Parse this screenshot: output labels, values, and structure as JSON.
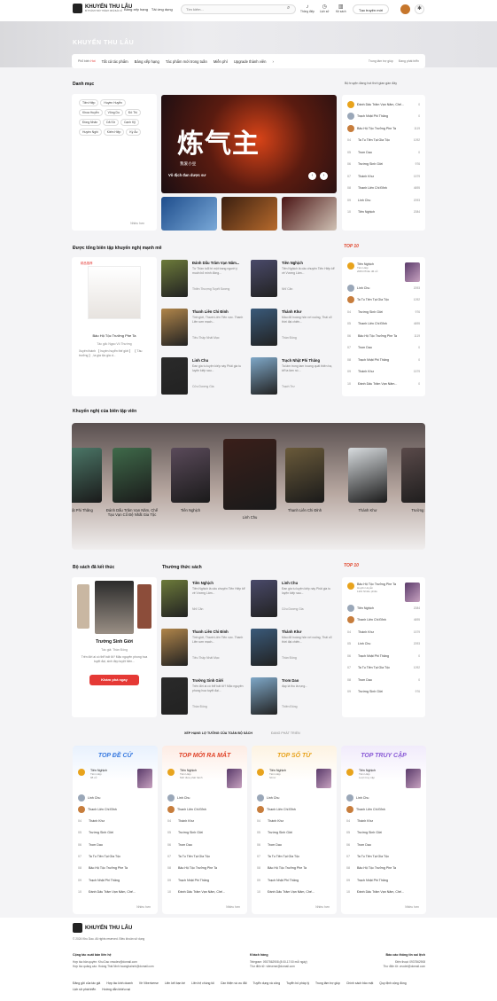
{
  "header": {
    "logo_title": "KHUYẾN THU LÂU",
    "logo_sub": "BÍ THÀNH TRỞ THÀNH NHÀ BÁC SĨ",
    "nav": [
      "Bảng xếp hạng",
      "Tải ứng dụng"
    ],
    "search_placeholder": "Tìm kiếm...",
    "icons": [
      {
        "label": "Thông điệp",
        "icon": "bell-icon"
      },
      {
        "label": "Lịch sử",
        "icon": "clock-icon"
      },
      {
        "label": "Kệ sách",
        "icon": "books-icon"
      }
    ],
    "create_label": "Tạo truyện mới"
  },
  "hero": {
    "title": "KHUYẾN THU LÂU"
  },
  "catbar": {
    "items": [
      "Phổ biến",
      "Tất cả tác phẩm",
      "Bảng xếp hạng",
      "Tác phẩm mới trong tuần",
      "Miễn phí",
      "Upgrade thành viên"
    ],
    "hot": "Hot",
    "right": [
      "Trung tâm trợ giúp",
      "Đang phát triển"
    ]
  },
  "categories": {
    "title": "Danh mục",
    "update_note": "Bộ truyện đang hot thời gian gần đây",
    "tags": [
      "Tiên Hiệp",
      "Huyền Huyễn",
      "Khoa Huyễn",
      "Võng Du",
      "Đô Thị",
      "Đồng Nhân",
      "Dã Sử",
      "Cạnh Kỹ",
      "Huyền Nghi",
      "Kiếm Hiệp",
      "Kỳ Ảo"
    ],
    "more": "Nhiều hơn"
  },
  "banner": {
    "title_art": "炼气主",
    "caption": "我爱小豆",
    "sub": "Vô địch đan dược sư"
  },
  "rank1": [
    {
      "name": "Đánh Dấu Trăm Vạn Năm, Chế...",
      "value": "0",
      "medal": "#e8a31c"
    },
    {
      "name": "Trạch Nhật Phi Thăng",
      "sub": "Tiên Hiệp",
      "sub2": "2 Không ảnh thủ",
      "value": "0",
      "medal": "#9aa7b8"
    },
    {
      "name": "Bảo Hộ Tộc Trưởng Phe Ta",
      "value": "1119",
      "medal": "#c77d3c"
    },
    {
      "name": "Ta Tu Tiên Tại Gia Tộc",
      "value": "1092",
      "n": "04"
    },
    {
      "name": "Trom Dao",
      "value": "0",
      "n": "05"
    },
    {
      "name": "Trường Sinh Giới",
      "value": "976",
      "n": "06"
    },
    {
      "name": "Thánh Khư",
      "value": "1579",
      "n": "07"
    },
    {
      "name": "Thanh Liên Chi Đỉnh",
      "value": "4695",
      "n": "08"
    },
    {
      "name": "Linh Chu",
      "value": "2093",
      "n": "09"
    },
    {
      "name": "Tiên Nghịch",
      "value": "2084",
      "n": "10"
    }
  ],
  "editor": {
    "title": "Được tổng biên tập khuyến nghị mạnh mẽ",
    "feature": {
      "badge": "精品推荐",
      "title": "Bảo Hộ Tộc Trưởng Phe Ta",
      "author": "Tác giả: Ngạo Vô Thường",
      "desc": "Xuyên thành 【 huyền huyễn thế giới 】 【 Tàu trưởng 】, ta gia tộc gia d..."
    },
    "books": [
      {
        "title": "Đánh Dấu Trăm Vạn Năm...",
        "desc": "Từ Thần tuổi tri một trang người ý muốn bỏ mình đồng...",
        "author": "Thiên Thượng Tuyết Sương"
      },
      {
        "title": "Tiên Nghịch",
        "desc": "Tiên Nghịch là câu chuyện Tiên Hiệp kể về Vương Lâm...",
        "author": "Nhĩ Căn"
      },
      {
        "title": "Thanh Liên Chi Đỉnh",
        "desc": "Tinh giới, Thanh Liên Tiên vực. Thanh Liên sơn mạch...",
        "author": "Tiêu Thập Nhất Mạc"
      },
      {
        "title": "Thánh Khư",
        "desc": "Màu đỏ hoàng hôn rơi xuống, Thái cổ thời đại chiến...",
        "author": "Thần Đông"
      },
      {
        "title": "Linh Chu",
        "desc": "Đan gia tu luyện kiếp này Phải gia tu luyện kiếp sau...",
        "author": "Cửu Dương Gia"
      },
      {
        "title": "Trạch Nhật Phi Thăng",
        "desc": "Ta làm trong tam hoang quát thiên hạ, kể ta làm nó ...",
        "author": "Trạch Trư"
      }
    ]
  },
  "top1": {
    "label": "TOP 10",
    "rows": [
      {
        "name": "Tiên Nghịch",
        "sub": "Tiên Hiệp",
        "sub2": "2084 Phiếu đề cử",
        "value": "",
        "medal": "#e8a31c"
      },
      {
        "name": "Linh Chu",
        "value": "2093",
        "medal": "#9aa7b8"
      },
      {
        "name": "Ta Tu Tiên Tại Gia Tộc",
        "value": "1092",
        "medal": "#c77d3c"
      },
      {
        "name": "Trường Sinh Giới",
        "value": "976",
        "n": "04"
      },
      {
        "name": "Thanh Liên Chi Đỉnh",
        "value": "4695",
        "n": "05"
      },
      {
        "name": "Bảo Hộ Tộc Trưởng Phe Ta",
        "value": "1119",
        "n": "06"
      },
      {
        "name": "Trom Dao",
        "value": "0",
        "n": "07"
      },
      {
        "name": "Trạch Nhật Phi Thăng",
        "value": "0",
        "n": "08"
      },
      {
        "name": "Thánh Khư",
        "value": "1579",
        "n": "09"
      },
      {
        "name": "Đánh Dấu Trăm Vạn Năm...",
        "value": "0",
        "n": "10"
      }
    ]
  },
  "carousel": {
    "title": "Khuyến nghị của biên tập viên",
    "items": [
      "ật Phi Thăng",
      "Đánh Dấu Trăm Vạn Năm, Chế Tạo Vạn Cổ Đệ Nhất Gia Tộc",
      "Tiên Nghịch",
      "Linh Chu",
      "Thanh Liên Chi Đỉnh",
      "Thánh Khư",
      "Trường Sin"
    ]
  },
  "finished": {
    "title": "Bộ sách đã kết thúc",
    "book": "Trường Sinh Giới",
    "author": "Tác giả: Thần Đông",
    "desc": "Trên đời ai có thể bất tử? Mặc nguyên phong hoa tuyệt đại, sinh đẹp tuyệt hiền...",
    "btn": "Khám phá ngay"
  },
  "common": {
    "title": "Thường thức sách",
    "books": [
      {
        "title": "Tiên Nghịch",
        "desc": "Tiên Nghịch là câu chuyện Tiên Hiệp kể về Vương Lâm...",
        "author": "Nhĩ Căn"
      },
      {
        "title": "Linh Chu",
        "desc": "Đan gia tu luyện kiếp này Phải gia tu luyện kiếp sau...",
        "author": "Cửu Dương Gia"
      },
      {
        "title": "Thanh Liên Chi Đỉnh",
        "desc": "Tinh giới, Thanh Liên Tiên vực. Thanh Liên sơn mạch...",
        "author": "Tiêu Thập Nhất Mạc"
      },
      {
        "title": "Thánh Khư",
        "desc": "Màu đỏ hoàng hôn rơi xuống, Thái cổ thời đại chiến...",
        "author": "Thần Đông"
      },
      {
        "title": "Trường Sinh Giới",
        "desc": "Trên đời ai có thể bất tử? Mặc nguyên phong hoa tuyệt đại...",
        "author": "Thần Đông"
      },
      {
        "title": "Trom Dao",
        "desc": "đạp lá thu lá rụng...",
        "author": "Thiên Đông"
      }
    ]
  },
  "top2": {
    "label": "TOP 10",
    "rows": [
      {
        "name": "Bảo Hộ Tộc Trưởng Phe Ta",
        "sub": "Huyền Huyễn",
        "sub2": "1119 Nhiều phiếu",
        "value": "",
        "medal": "#e8a31c"
      },
      {
        "name": "Tiên Nghịch",
        "value": "2084",
        "medal": "#9aa7b8"
      },
      {
        "name": "Thanh Liên Chi Đỉnh",
        "value": "4695",
        "medal": "#c77d3c"
      },
      {
        "name": "Thánh Khư",
        "value": "1579",
        "n": "04"
      },
      {
        "name": "Linh Chu",
        "value": "2093",
        "n": "05"
      },
      {
        "name": "Trạch Nhật Phi Thăng",
        "value": "0",
        "n": "06"
      },
      {
        "name": "Ta Tu Tiên Tại Gia Tộc",
        "value": "1092",
        "n": "07"
      },
      {
        "name": "Trom Dao",
        "value": "0",
        "n": "08"
      },
      {
        "name": "Trường Sinh Giới",
        "value": "976",
        "n": "09"
      }
    ]
  },
  "leaderboard": {
    "tabs": [
      "XẾP HẠNG LỢ TƯỞNG CỦA TOÀN BỘ SÁCH",
      "ĐANG PHÁT TRIỂN"
    ],
    "boards": [
      {
        "title": "TOP ĐỀ CỬ",
        "color": "#3a7be0",
        "bg": "#e8f1fd",
        "first": "Tiên Nghịch",
        "sub": "Tiên Hiệp",
        "sub2": "98 cử",
        "rows": [
          "Linh Chu",
          "Thanh Liên Chi Đỉnh",
          "Thánh Khư",
          "Trường Sinh Giới",
          "Trom Dao",
          "Ta Tu Tiên Tại Gia Tộc",
          "Bảo Hộ Tộc Trưởng Phe Ta",
          "Trạch Nhật Phi Thăng",
          "Đánh Dấu Trăm Vạn Năm, Chế..."
        ]
      },
      {
        "title": "TOP MỚI RA MẮT",
        "color": "#e0452b",
        "bg": "#fdece4",
        "first": "Tiên Nghịch",
        "sub": "Tiên Hiệp",
        "sub2": "Mới đưa phát hành",
        "rows": [
          "Linh Chu",
          "Thanh Liên Chi Đỉnh",
          "Thánh Khư",
          "Trường Sinh Giới",
          "Trom Dao",
          "Ta Tu Tiên Tại Gia Tộc",
          "Bảo Hộ Tộc Trưởng Phe Ta",
          "Trạch Nhật Phi Thăng",
          "Đánh Dấu Trăm Vạn Năm, Chế..."
        ]
      },
      {
        "title": "TOP SỐ TỪ",
        "color": "#e8a31c",
        "bg": "#fdf3e2",
        "first": "Tiên Nghịch",
        "sub": "Tiên Hiệp",
        "sub2": "Số từ",
        "rows": [
          "Linh Chu",
          "Thanh Liên Chi Đỉnh",
          "Thánh Khư",
          "Trường Sinh Giới",
          "Trom Dao",
          "Ta Tu Tiên Tại Gia Tộc",
          "Bảo Hộ Tộc Trưởng Phe Ta",
          "Trạch Nhật Phi Thăng",
          "Đánh Dấu Trăm Vạn Năm, Chế..."
        ]
      },
      {
        "title": "TOP TRUY CẬP",
        "color": "#8a5bd6",
        "bg": "#f1ebfb",
        "first": "Tiên Nghịch",
        "sub": "Tiên Hiệp",
        "sub2": "Lượt truy cập",
        "rows": [
          "Linh Chu",
          "Thanh Liên Chi Đỉnh",
          "Thánh Khư",
          "Trường Sinh Giới",
          "Trom Dao",
          "Ta Tu Tiên Tại Gia Tộc",
          "Bảo Hộ Tộc Trưởng Phe Ta",
          "Trạch Nhật Phi Thăng",
          "Đánh Dấu Trăm Vạn Năm, Chế..."
        ]
      }
    ],
    "more": "Nhiều hơn"
  },
  "footer": {
    "logo": "KHUYẾN THU LÂU",
    "copyright": "© 2024 Khu Dao. All rights reserved. Điều khoản sử dụng",
    "col1_title": "Cộng tác xuất bản liên hệ",
    "col1": [
      "Hợp tác bản quyền: Khu Dao vmodev@domail.com",
      "Hợp tác quảng cáo: Hoàng Thái Ninh hoanghainnh@domail.com"
    ],
    "col2_title": "Khách hàng",
    "col2": [
      "Telegram: 0937562908 (8:00-17:00 mỗi ngày)",
      "Thư điện tử: vtieverse@domail.com"
    ],
    "col3_title": "Báo cáo thông tin sai lệch",
    "col3": [
      "Điện thoại: 0937562908",
      "Thư điện tử: vnodet@domail.com"
    ],
    "links": [
      "Đăng gửi của tác giả",
      "Hợp tác kinh doanh",
      "Về Viberiverse",
      "Liên kết bạn bè",
      "Liên hệ chúng tôi",
      "Cần thiện và ưu đãi",
      "Tuyển dụng và công",
      "Tuyển bố pháp lý",
      "Trung tâm trợ giúp",
      "Chính sách bảo mật",
      "Quy định cộng đồng",
      "Lịch sử phát triển",
      "Hướng dẫn khiếu nại"
    ]
  },
  "colors": {
    "accent": "#e53935",
    "gold": "#e8a31c",
    "silver": "#9aa7b8",
    "bronze": "#c77d3c"
  }
}
